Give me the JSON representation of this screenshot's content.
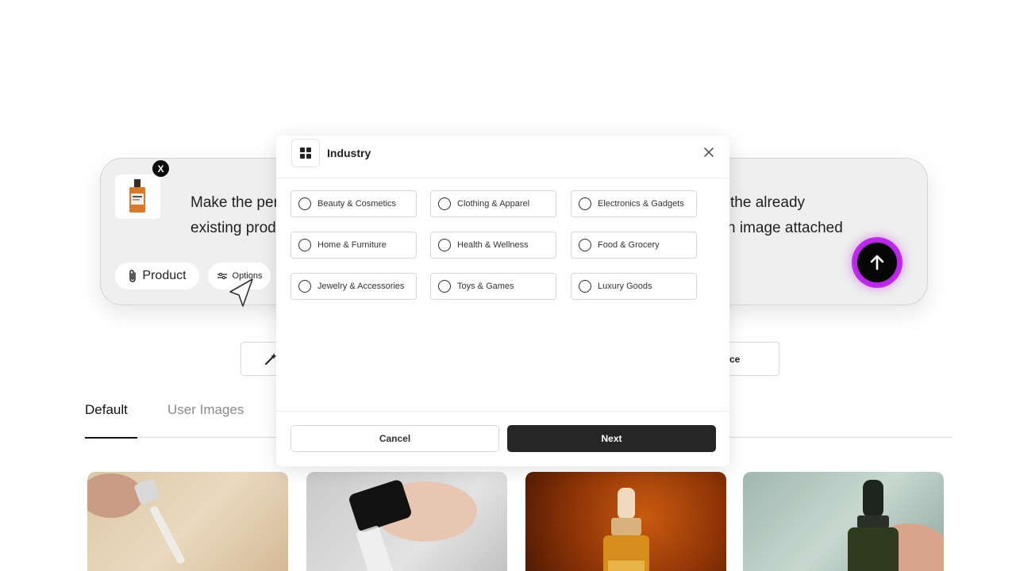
{
  "prompt": {
    "line1_left": "Make the per",
    "line1_right": "the already",
    "line2_left": "existing prod",
    "line2_right": "n image attached",
    "thumb_close": "X",
    "product_pill": "Product",
    "options_pill": "Options",
    "send_icon": "arrow-up-icon",
    "accent_gradient": [
      "#7a1fd1",
      "#d33df0"
    ]
  },
  "background": {
    "right_button_fragment": "ce"
  },
  "tabs": [
    {
      "label": "Default",
      "active": true
    },
    {
      "label": "User Images",
      "active": false
    }
  ],
  "modal": {
    "title": "Industry",
    "title_icon": "grid-icon",
    "close_icon": "close-icon",
    "options": [
      "Beauty & Cosmetics",
      "Clothing & Apparel",
      "Electronics & Gadgets",
      "Home & Furniture",
      "Health & Wellness",
      "Food & Grocery",
      "Jewelry & Accessories",
      "Toys & Games",
      "Luxury Goods"
    ],
    "cancel_label": "Cancel",
    "next_label": "Next",
    "primary_color": "#262626"
  }
}
